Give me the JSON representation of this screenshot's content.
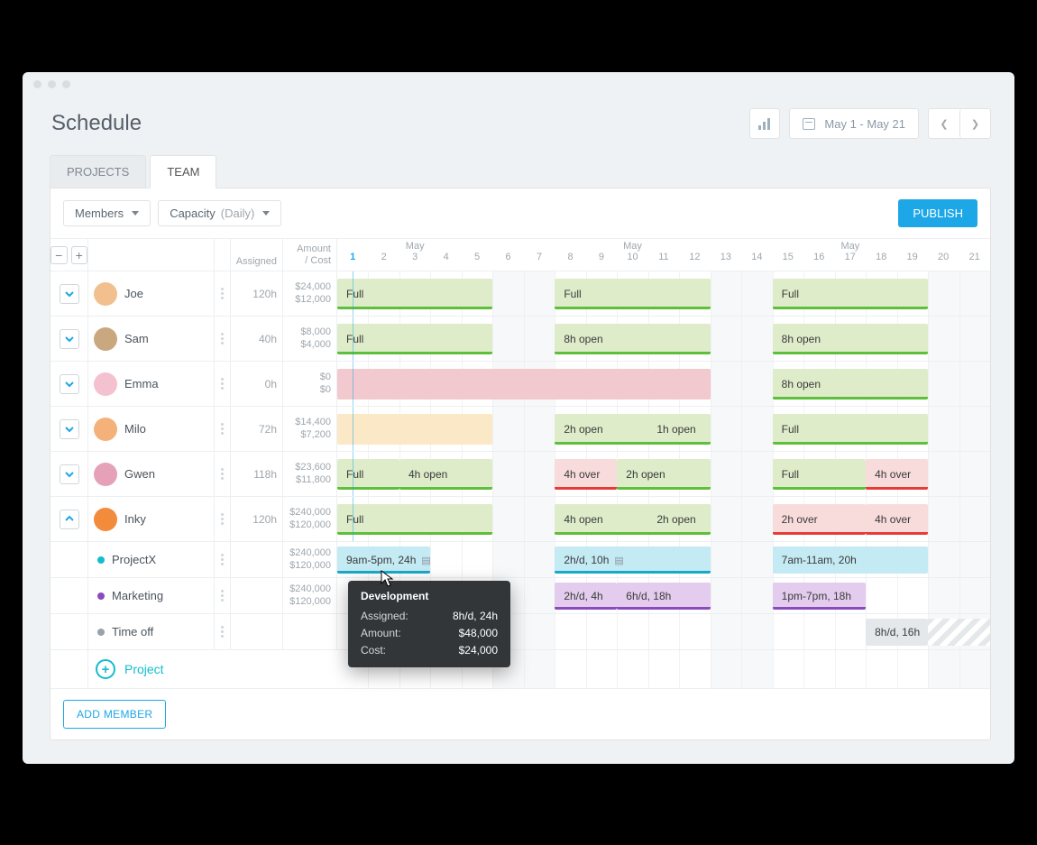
{
  "page": {
    "title": "Schedule"
  },
  "date_range": "May 1 - May 21",
  "tabs": {
    "projects": "PROJECTS",
    "team": "TEAM",
    "active": "team"
  },
  "toolbar": {
    "members_label": "Members",
    "capacity_label": "Capacity",
    "capacity_mode": "(Daily)",
    "publish_label": "PUBLISH"
  },
  "header": {
    "assigned": "Assigned",
    "amount_line1": "Amount",
    "amount_line2": "/ Cost",
    "month": "May",
    "days": [
      "1",
      "2",
      "3",
      "4",
      "5",
      "6",
      "7",
      "8",
      "9",
      "10",
      "11",
      "12",
      "13",
      "14",
      "15",
      "16",
      "17",
      "18",
      "19",
      "20",
      "21"
    ],
    "today_index": 0
  },
  "members": [
    {
      "name": "Joe",
      "avatar_bg": "#f2c08e",
      "assigned": "120h",
      "amount": "$24,000",
      "cost": "$12,000",
      "bars": [
        {
          "label": "Full",
          "type": "green",
          "start": 0,
          "span": 5
        },
        {
          "label": "Full",
          "type": "green",
          "start": 7,
          "span": 5
        },
        {
          "label": "Full",
          "type": "green",
          "start": 14,
          "span": 5
        }
      ]
    },
    {
      "name": "Sam",
      "avatar_bg": "#c9a880",
      "assigned": "40h",
      "amount": "$8,000",
      "cost": "$4,000",
      "bars": [
        {
          "label": "Full",
          "type": "green",
          "start": 0,
          "span": 5
        },
        {
          "label": "8h open",
          "type": "green",
          "start": 7,
          "span": 5
        },
        {
          "label": "8h open",
          "type": "green",
          "start": 14,
          "span": 5
        }
      ]
    },
    {
      "name": "Emma",
      "avatar_bg": "#f4c1d0",
      "assigned": "0h",
      "amount": "$0",
      "cost": "$0",
      "bars": [
        {
          "label": "",
          "type": "pink",
          "start": 0,
          "span": 12
        },
        {
          "label": "8h open",
          "type": "green",
          "start": 14,
          "span": 5
        }
      ]
    },
    {
      "name": "Milo",
      "avatar_bg": "#f4b27a",
      "assigned": "72h",
      "amount": "$14,400",
      "cost": "$7,200",
      "bars": [
        {
          "label": "",
          "type": "yellow",
          "start": 0,
          "span": 5
        },
        {
          "label": "2h open",
          "label2": "1h open",
          "type": "green",
          "start": 7,
          "span": 5
        },
        {
          "label": "Full",
          "type": "green",
          "start": 14,
          "span": 5
        }
      ]
    },
    {
      "name": "Gwen",
      "avatar_bg": "#e4a1b7",
      "assigned": "118h",
      "amount": "$23,600",
      "cost": "$11,800",
      "bars": [
        {
          "label": "Full",
          "type": "green",
          "start": 0,
          "span": 2
        },
        {
          "label": "4h open",
          "type": "green",
          "start": 2,
          "span": 3
        },
        {
          "label": "4h over",
          "type": "red",
          "start": 7,
          "span": 2
        },
        {
          "label": "2h open",
          "type": "green",
          "start": 9,
          "span": 3
        },
        {
          "label": "Full",
          "type": "green",
          "start": 14,
          "span": 3
        },
        {
          "label": "4h over",
          "type": "red",
          "start": 17,
          "span": 2
        }
      ]
    },
    {
      "name": "Inky",
      "avatar_bg": "#f38b3c",
      "assigned": "120h",
      "amount": "$240,000",
      "cost": "$120,000",
      "expanded": true,
      "bars": [
        {
          "label": "Full",
          "type": "green",
          "start": 0,
          "span": 5
        },
        {
          "label": "4h open",
          "label2": "2h open",
          "type": "green",
          "start": 7,
          "span": 5
        },
        {
          "label": "2h over",
          "type": "red",
          "start": 14,
          "span": 3
        },
        {
          "label": "4h over",
          "type": "red",
          "start": 17,
          "span": 2
        }
      ]
    }
  ],
  "sub_projects": [
    {
      "name": "ProjectX",
      "dot": "proj-cyan",
      "amount": "$240,000",
      "cost": "$120,000",
      "bars": [
        {
          "label": "9am-5pm, 24h",
          "has_note": true,
          "type": "blue",
          "start": 0,
          "span": 3
        },
        {
          "label": "2h/d, 10h",
          "has_note": true,
          "type": "blue",
          "start": 7,
          "span": 5
        },
        {
          "label": "7am-11am, 20h",
          "type": "blue-plain",
          "start": 14,
          "span": 5
        }
      ]
    },
    {
      "name": "Marketing",
      "dot": "proj-purple",
      "amount": "$240,000",
      "cost": "$120,000",
      "bars": [
        {
          "label": "2h/d, 4h",
          "type": "purple",
          "start": 7,
          "span": 2
        },
        {
          "label": "6h/d, 18h",
          "type": "purple",
          "start": 9,
          "span": 3
        },
        {
          "label": "1pm-7pm, 18h",
          "type": "purple",
          "start": 14,
          "span": 3
        }
      ]
    },
    {
      "name": "Time off",
      "dot": "proj-grey",
      "bars": [
        {
          "label": "8h/d, 16h",
          "type": "grey",
          "start": 17,
          "span": 2
        }
      ],
      "hatched": {
        "start": 19,
        "span": 2
      }
    }
  ],
  "add_project_label": "Project",
  "add_member_label": "ADD MEMBER",
  "tooltip": {
    "title": "Development",
    "assigned_label": "Assigned:",
    "assigned_value": "8h/d, 24h",
    "amount_label": "Amount:",
    "amount_value": "$48,000",
    "cost_label": "Cost:",
    "cost_value": "$24,000"
  }
}
